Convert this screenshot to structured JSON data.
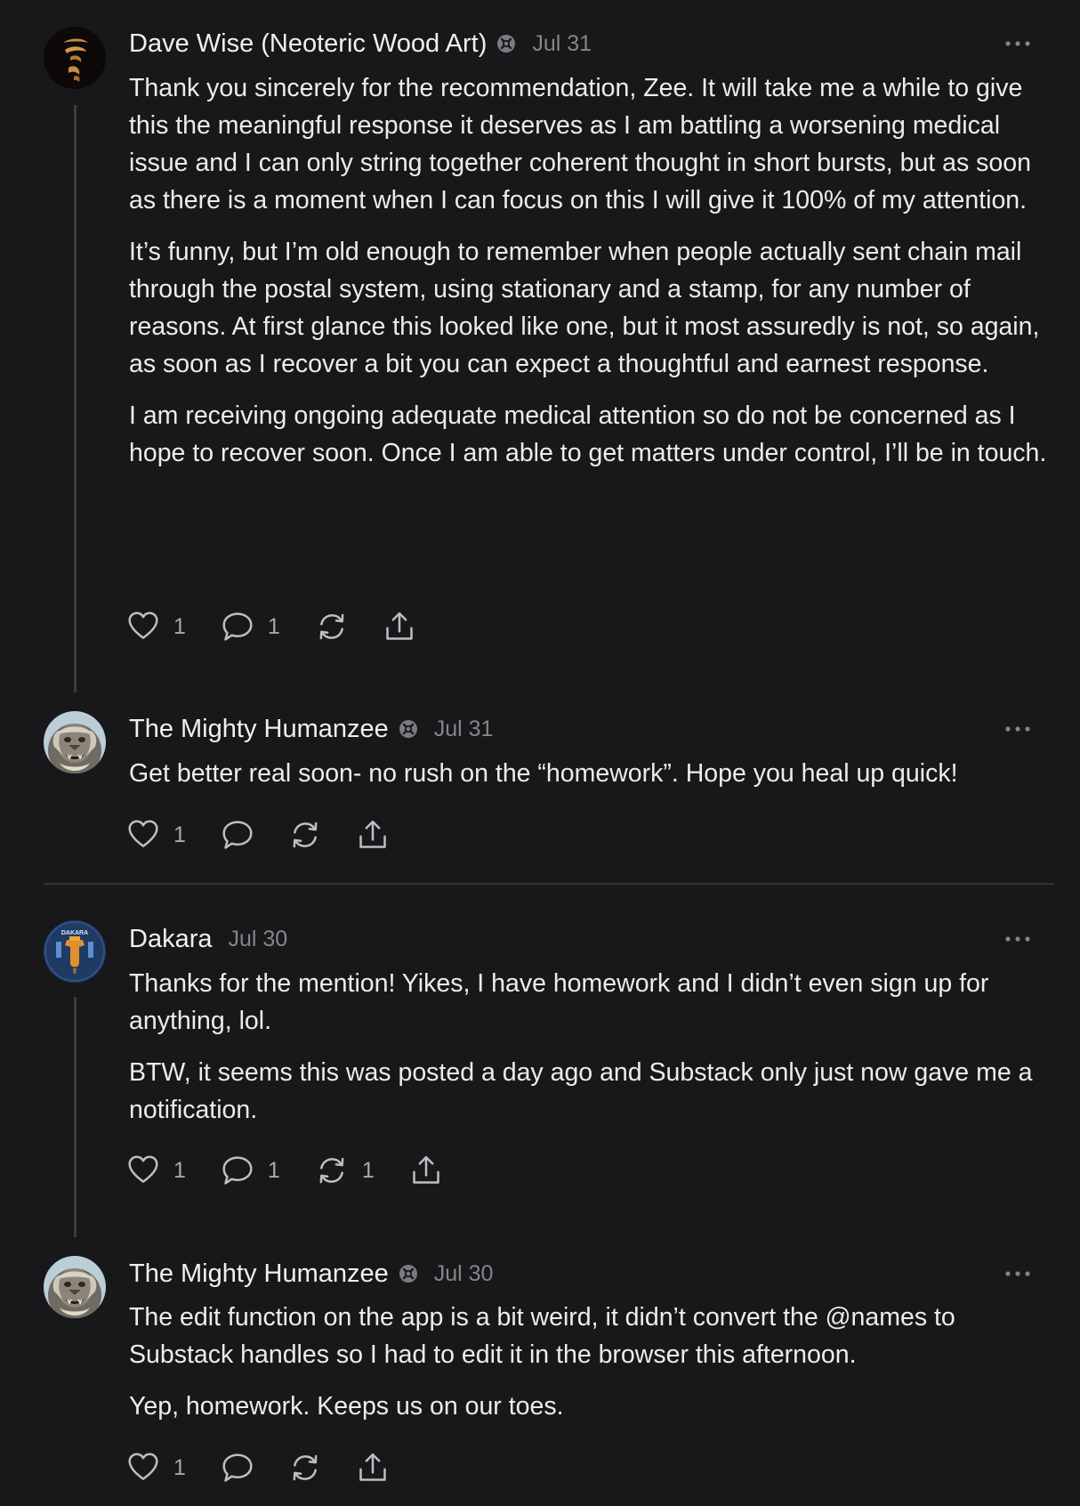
{
  "comments": [
    {
      "author": "Dave Wise (Neoteric Wood Art)",
      "date": "Jul 31",
      "paragraphs": [
        "Thank you sincerely for the recommendation, Zee. It will take me a while to give this the meaningful response it deserves as I am battling a worsening medical issue and I can only string together coherent thought in short bursts, but as soon as there is a moment when I can focus on this I will give it 100% of my attention.",
        "It’s funny, but I’m old enough to remember when people actually sent chain mail through the postal system, using stationary and a stamp, for any number of reasons. At first glance this looked like one, but it most assuredly is not, so again, as soon as I recover a bit you can expect a thoughtful and earnest response.",
        "I am receiving ongoing adequate medical attention so do not be concerned as I hope to recover soon. Once I am able to get matters under control, I’ll be in touch."
      ],
      "likes": "1",
      "replies": "1",
      "restacks": ""
    },
    {
      "author": "The Mighty Humanzee",
      "date": "Jul 31",
      "paragraphs": [
        "Get better real soon- no rush on the “homework”. Hope you heal up quick!"
      ],
      "likes": "1",
      "replies": "",
      "restacks": ""
    },
    {
      "author": "Dakara",
      "date": "Jul 30",
      "avatar_text": "DAKARA",
      "paragraphs": [
        "Thanks for the mention! Yikes, I have homework and I didn’t even sign up for anything, lol.",
        "BTW, it seems this was posted a day ago and Substack only just now gave me a notification."
      ],
      "likes": "1",
      "replies": "1",
      "restacks": "1"
    },
    {
      "author": "The Mighty Humanzee",
      "date": "Jul 30",
      "paragraphs": [
        "The edit function on the app is a bit weird, it didn’t convert the @names to Substack handles so I had to edit it in the browser this afternoon.",
        "Yep, homework. Keeps us on our toes."
      ],
      "likes": "1",
      "replies": "",
      "restacks": ""
    }
  ],
  "icons": {
    "like": "heart-icon",
    "reply": "comment-bubble-icon",
    "restack": "restack-icon",
    "share": "share-icon",
    "more": "ellipsis-icon",
    "badge": "subscriber-badge-icon"
  },
  "colors": {
    "background": "#18181a",
    "text": "#ececec",
    "muted": "#85858a",
    "thread_line": "#3d3d40",
    "icon": "#bdbdc2"
  }
}
